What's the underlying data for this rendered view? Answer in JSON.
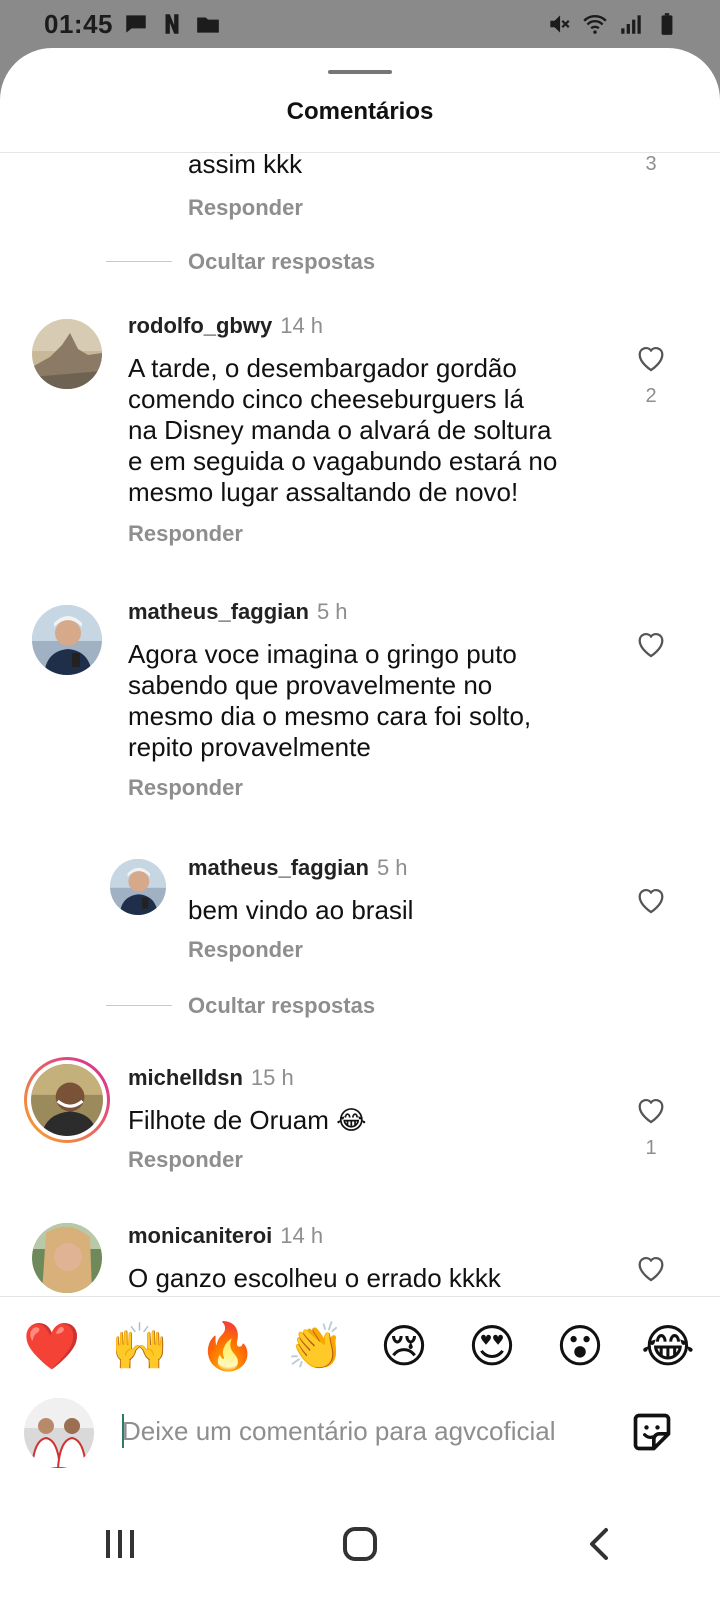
{
  "status_bar": {
    "time": "01:45",
    "notification_icons": [
      "chat-bubble-icon",
      "netflix-icon",
      "folder-icon"
    ],
    "system_icons": [
      "mute-icon",
      "wifi-icon",
      "signal-icon",
      "battery-icon"
    ]
  },
  "sheet": {
    "title": "Comentários"
  },
  "comments": [
    {
      "id": "partial",
      "text": "assim kkk",
      "reply_label": "Responder",
      "like_count": "3"
    },
    {
      "id": "hide-1",
      "hide_label": "Ocultar respostas"
    },
    {
      "id": "rodolfo",
      "username": "rodolfo_gbwy",
      "time": "14 h",
      "lines": [
        "A tarde, o desembargador gordão",
        "comendo cinco cheeseburguers lá",
        "na Disney manda o alvará de soltura",
        "e em seguida o vagabundo estará no",
        "mesmo lugar assaltando de novo!"
      ],
      "reply_label": "Responder",
      "like_count": "2"
    },
    {
      "id": "matheus",
      "username": "matheus_faggian",
      "time": "5 h",
      "lines": [
        "Agora voce imagina o gringo puto",
        "sabendo que provavelmente no",
        "mesmo dia o mesmo cara foi solto,",
        "repito provavelmente"
      ],
      "reply_label": "Responder"
    },
    {
      "id": "matheus-reply",
      "username": "matheus_faggian",
      "time": "5 h",
      "lines": [
        "bem vindo ao brasil"
      ],
      "reply_label": "Responder"
    },
    {
      "id": "hide-2",
      "hide_label": "Ocultar respostas"
    },
    {
      "id": "michell",
      "username": "michelldsn",
      "time": "15 h",
      "lines": [
        "Filhote de Oruam 😂"
      ],
      "reply_label": "Responder",
      "like_count": "1"
    },
    {
      "id": "monica",
      "username": "monicaniteroi",
      "time": "14 h",
      "lines": [
        "O ganzo escolheu o errado kkkk"
      ]
    }
  ],
  "reactions": [
    "❤️",
    "🙌",
    "🔥",
    "👏",
    "😢",
    "😍",
    "😮",
    "😂"
  ],
  "composer": {
    "placeholder": "Deixe um comentário para agvcoficial",
    "sticker_icon": "sticker-icon"
  },
  "nav": {
    "buttons": [
      "recents-icon",
      "home-icon",
      "back-icon"
    ]
  },
  "colors": {
    "scrim": "#8a8a8a",
    "muted_text": "#8e8e8e",
    "story_ring_start": "#f9a825",
    "story_ring_end": "#d6249f"
  }
}
